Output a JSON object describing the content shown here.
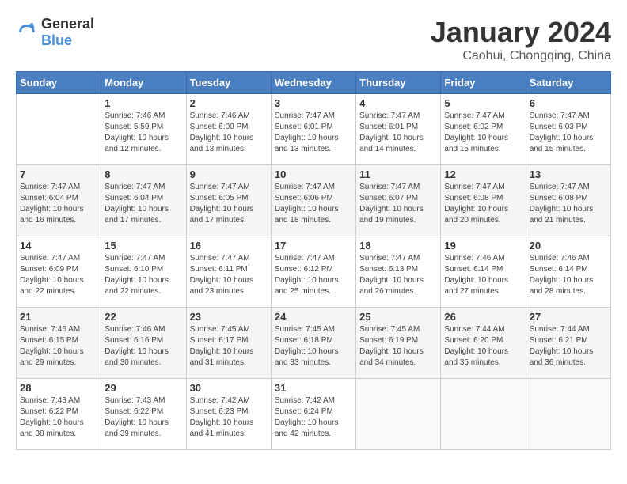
{
  "header": {
    "logo_general": "General",
    "logo_blue": "Blue",
    "month_year": "January 2024",
    "location": "Caohui, Chongqing, China"
  },
  "weekdays": [
    "Sunday",
    "Monday",
    "Tuesday",
    "Wednesday",
    "Thursday",
    "Friday",
    "Saturday"
  ],
  "weeks": [
    [
      {
        "day": "",
        "sunrise": "",
        "sunset": "",
        "daylight": ""
      },
      {
        "day": "1",
        "sunrise": "Sunrise: 7:46 AM",
        "sunset": "Sunset: 5:59 PM",
        "daylight": "Daylight: 10 hours and 12 minutes."
      },
      {
        "day": "2",
        "sunrise": "Sunrise: 7:46 AM",
        "sunset": "Sunset: 6:00 PM",
        "daylight": "Daylight: 10 hours and 13 minutes."
      },
      {
        "day": "3",
        "sunrise": "Sunrise: 7:47 AM",
        "sunset": "Sunset: 6:01 PM",
        "daylight": "Daylight: 10 hours and 13 minutes."
      },
      {
        "day": "4",
        "sunrise": "Sunrise: 7:47 AM",
        "sunset": "Sunset: 6:01 PM",
        "daylight": "Daylight: 10 hours and 14 minutes."
      },
      {
        "day": "5",
        "sunrise": "Sunrise: 7:47 AM",
        "sunset": "Sunset: 6:02 PM",
        "daylight": "Daylight: 10 hours and 15 minutes."
      },
      {
        "day": "6",
        "sunrise": "Sunrise: 7:47 AM",
        "sunset": "Sunset: 6:03 PM",
        "daylight": "Daylight: 10 hours and 15 minutes."
      }
    ],
    [
      {
        "day": "7",
        "sunrise": "Sunrise: 7:47 AM",
        "sunset": "Sunset: 6:04 PM",
        "daylight": "Daylight: 10 hours and 16 minutes."
      },
      {
        "day": "8",
        "sunrise": "Sunrise: 7:47 AM",
        "sunset": "Sunset: 6:04 PM",
        "daylight": "Daylight: 10 hours and 17 minutes."
      },
      {
        "day": "9",
        "sunrise": "Sunrise: 7:47 AM",
        "sunset": "Sunset: 6:05 PM",
        "daylight": "Daylight: 10 hours and 17 minutes."
      },
      {
        "day": "10",
        "sunrise": "Sunrise: 7:47 AM",
        "sunset": "Sunset: 6:06 PM",
        "daylight": "Daylight: 10 hours and 18 minutes."
      },
      {
        "day": "11",
        "sunrise": "Sunrise: 7:47 AM",
        "sunset": "Sunset: 6:07 PM",
        "daylight": "Daylight: 10 hours and 19 minutes."
      },
      {
        "day": "12",
        "sunrise": "Sunrise: 7:47 AM",
        "sunset": "Sunset: 6:08 PM",
        "daylight": "Daylight: 10 hours and 20 minutes."
      },
      {
        "day": "13",
        "sunrise": "Sunrise: 7:47 AM",
        "sunset": "Sunset: 6:08 PM",
        "daylight": "Daylight: 10 hours and 21 minutes."
      }
    ],
    [
      {
        "day": "14",
        "sunrise": "Sunrise: 7:47 AM",
        "sunset": "Sunset: 6:09 PM",
        "daylight": "Daylight: 10 hours and 22 minutes."
      },
      {
        "day": "15",
        "sunrise": "Sunrise: 7:47 AM",
        "sunset": "Sunset: 6:10 PM",
        "daylight": "Daylight: 10 hours and 22 minutes."
      },
      {
        "day": "16",
        "sunrise": "Sunrise: 7:47 AM",
        "sunset": "Sunset: 6:11 PM",
        "daylight": "Daylight: 10 hours and 23 minutes."
      },
      {
        "day": "17",
        "sunrise": "Sunrise: 7:47 AM",
        "sunset": "Sunset: 6:12 PM",
        "daylight": "Daylight: 10 hours and 25 minutes."
      },
      {
        "day": "18",
        "sunrise": "Sunrise: 7:47 AM",
        "sunset": "Sunset: 6:13 PM",
        "daylight": "Daylight: 10 hours and 26 minutes."
      },
      {
        "day": "19",
        "sunrise": "Sunrise: 7:46 AM",
        "sunset": "Sunset: 6:14 PM",
        "daylight": "Daylight: 10 hours and 27 minutes."
      },
      {
        "day": "20",
        "sunrise": "Sunrise: 7:46 AM",
        "sunset": "Sunset: 6:14 PM",
        "daylight": "Daylight: 10 hours and 28 minutes."
      }
    ],
    [
      {
        "day": "21",
        "sunrise": "Sunrise: 7:46 AM",
        "sunset": "Sunset: 6:15 PM",
        "daylight": "Daylight: 10 hours and 29 minutes."
      },
      {
        "day": "22",
        "sunrise": "Sunrise: 7:46 AM",
        "sunset": "Sunset: 6:16 PM",
        "daylight": "Daylight: 10 hours and 30 minutes."
      },
      {
        "day": "23",
        "sunrise": "Sunrise: 7:45 AM",
        "sunset": "Sunset: 6:17 PM",
        "daylight": "Daylight: 10 hours and 31 minutes."
      },
      {
        "day": "24",
        "sunrise": "Sunrise: 7:45 AM",
        "sunset": "Sunset: 6:18 PM",
        "daylight": "Daylight: 10 hours and 33 minutes."
      },
      {
        "day": "25",
        "sunrise": "Sunrise: 7:45 AM",
        "sunset": "Sunset: 6:19 PM",
        "daylight": "Daylight: 10 hours and 34 minutes."
      },
      {
        "day": "26",
        "sunrise": "Sunrise: 7:44 AM",
        "sunset": "Sunset: 6:20 PM",
        "daylight": "Daylight: 10 hours and 35 minutes."
      },
      {
        "day": "27",
        "sunrise": "Sunrise: 7:44 AM",
        "sunset": "Sunset: 6:21 PM",
        "daylight": "Daylight: 10 hours and 36 minutes."
      }
    ],
    [
      {
        "day": "28",
        "sunrise": "Sunrise: 7:43 AM",
        "sunset": "Sunset: 6:22 PM",
        "daylight": "Daylight: 10 hours and 38 minutes."
      },
      {
        "day": "29",
        "sunrise": "Sunrise: 7:43 AM",
        "sunset": "Sunset: 6:22 PM",
        "daylight": "Daylight: 10 hours and 39 minutes."
      },
      {
        "day": "30",
        "sunrise": "Sunrise: 7:42 AM",
        "sunset": "Sunset: 6:23 PM",
        "daylight": "Daylight: 10 hours and 41 minutes."
      },
      {
        "day": "31",
        "sunrise": "Sunrise: 7:42 AM",
        "sunset": "Sunset: 6:24 PM",
        "daylight": "Daylight: 10 hours and 42 minutes."
      },
      {
        "day": "",
        "sunrise": "",
        "sunset": "",
        "daylight": ""
      },
      {
        "day": "",
        "sunrise": "",
        "sunset": "",
        "daylight": ""
      },
      {
        "day": "",
        "sunrise": "",
        "sunset": "",
        "daylight": ""
      }
    ]
  ]
}
